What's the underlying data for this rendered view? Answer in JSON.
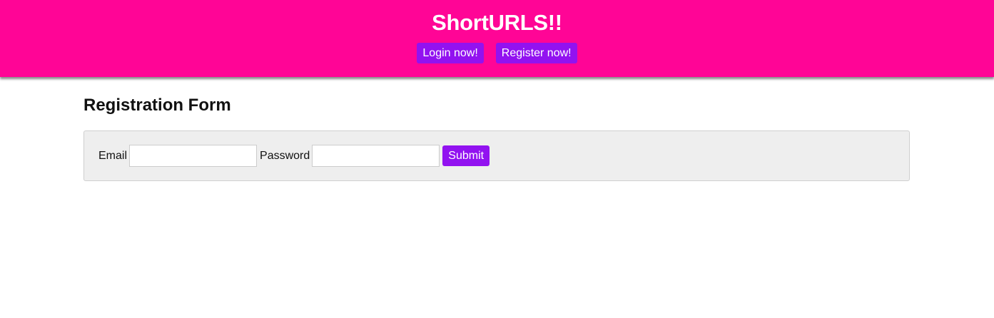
{
  "header": {
    "title": "ShortURLS!!",
    "nav": {
      "login_label": "Login now!",
      "register_label": "Register now!"
    },
    "colors": {
      "background": "#ff0596",
      "button": "#9212f0"
    }
  },
  "main": {
    "title": "Registration Form",
    "form": {
      "email_label": "Email",
      "email_value": "",
      "password_label": "Password",
      "password_value": "",
      "submit_label": "Submit"
    }
  }
}
